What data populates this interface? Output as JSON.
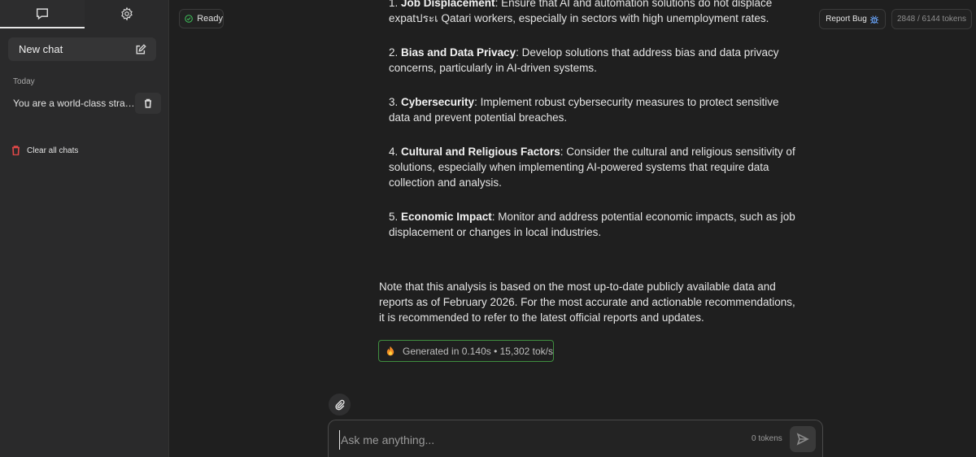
{
  "sidebar": {
    "tabs": [
      {
        "icon": "chat-bubble-icon",
        "active": true
      },
      {
        "icon": "gear-icon",
        "active": false
      }
    ],
    "new_chat_label": "New chat",
    "section_label": "Today",
    "chats": [
      {
        "title": "You are a world-class strat..."
      }
    ],
    "clear_all_label": "Clear all chats"
  },
  "header": {
    "status_label": "Ready",
    "report_bug_label": "Report Bug",
    "token_usage": "2848 / 6144 tokens"
  },
  "message": {
    "items": [
      {
        "num": "1. ",
        "title": "Job Displacement",
        "text": ": Ensure that AI and automation solutions do not displace expatประเ Qatari workers, especially in sectors with high unemployment rates."
      },
      {
        "num": "2. ",
        "title": "Bias and Data Privacy",
        "text": ": Develop solutions that address bias and data privacy concerns, particularly in AI-driven systems."
      },
      {
        "num": "3. ",
        "title": "Cybersecurity",
        "text": ": Implement robust cybersecurity measures to protect sensitive data and prevent potential breaches."
      },
      {
        "num": "4. ",
        "title": "Cultural and Religious Factors",
        "text": ": Consider the cultural and religious sensitivity of solutions, especially when implementing AI-powered systems that require data collection and analysis."
      },
      {
        "num": "5. ",
        "title": "Economic Impact",
        "text": ": Monitor and address potential economic impacts, such as job displacement or changes in local industries."
      }
    ],
    "note": "Note that this analysis is based on the most up-to-date publicly available data and reports as of February 2026. For the most accurate and actionable recommendations, it is recommended to refer to the latest official reports and updates.",
    "generation_stats": "Generated in 0.140s • 15,302 tok/s"
  },
  "composer": {
    "placeholder": "Ask me anything...",
    "value": "",
    "token_count": "0 tokens"
  },
  "colors": {
    "accent_green": "#3f8f3f",
    "danger_red": "#e04848",
    "background": "#1f1f1f",
    "sidebar": "#2a2a2b"
  }
}
